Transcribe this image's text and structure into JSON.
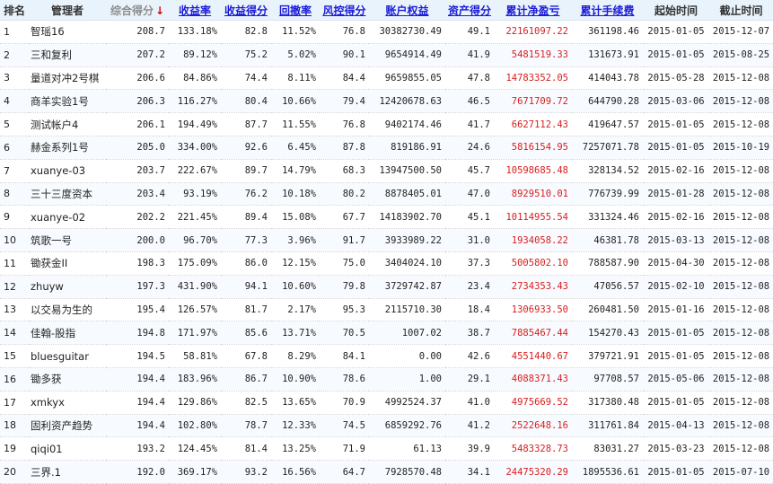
{
  "headers": {
    "rank": "排名",
    "manager": "管理者",
    "score": "综合得分",
    "score_arrow": "↓",
    "return_rate": "收益率",
    "return_score": "收益得分",
    "drawdown": "回撤率",
    "risk_score": "风控得分",
    "equity": "账户权益",
    "asset_score": "资产得分",
    "net_profit": "累计净盈亏",
    "fee": "累计手续费",
    "start": "起始时间",
    "end": "截止时间"
  },
  "colors": {
    "link": "#1a1ad8",
    "profit": "#d81e1e",
    "header_bg": "#e9f3fb"
  },
  "rows": [
    {
      "rank": "1",
      "name": "智瑶16",
      "score": "208.7",
      "return_rate": "133.18%",
      "return_score": "82.8",
      "drawdown": "11.52%",
      "risk_score": "76.8",
      "equity": "30382730.49",
      "asset_score": "49.1",
      "net_profit": "22161097.22",
      "fee": "361198.46",
      "start": "2015-01-05",
      "end": "2015-12-07"
    },
    {
      "rank": "2",
      "name": "三和复利",
      "score": "207.2",
      "return_rate": "89.12%",
      "return_score": "75.2",
      "drawdown": "5.02%",
      "risk_score": "90.1",
      "equity": "9654914.49",
      "asset_score": "41.9",
      "net_profit": "5481519.33",
      "fee": "131673.91",
      "start": "2015-01-05",
      "end": "2015-08-25"
    },
    {
      "rank": "3",
      "name": "量道对冲2号棋",
      "score": "206.6",
      "return_rate": "84.86%",
      "return_score": "74.4",
      "drawdown": "8.11%",
      "risk_score": "84.4",
      "equity": "9659855.05",
      "asset_score": "47.8",
      "net_profit": "14783352.05",
      "fee": "414043.78",
      "start": "2015-05-28",
      "end": "2015-12-08"
    },
    {
      "rank": "4",
      "name": "商羊实验1号",
      "score": "206.3",
      "return_rate": "116.27%",
      "return_score": "80.4",
      "drawdown": "10.66%",
      "risk_score": "79.4",
      "equity": "12420678.63",
      "asset_score": "46.5",
      "net_profit": "7671709.72",
      "fee": "644790.28",
      "start": "2015-03-06",
      "end": "2015-12-08"
    },
    {
      "rank": "5",
      "name": "测试帐户4",
      "score": "206.1",
      "return_rate": "194.49%",
      "return_score": "87.7",
      "drawdown": "11.55%",
      "risk_score": "76.8",
      "equity": "9402174.46",
      "asset_score": "41.7",
      "net_profit": "6627112.43",
      "fee": "419647.57",
      "start": "2015-01-05",
      "end": "2015-12-08"
    },
    {
      "rank": "6",
      "name": "赫金系列1号",
      "score": "205.0",
      "return_rate": "334.00%",
      "return_score": "92.6",
      "drawdown": "6.45%",
      "risk_score": "87.8",
      "equity": "819186.91",
      "asset_score": "24.6",
      "net_profit": "5816154.95",
      "fee": "7257071.78",
      "start": "2015-01-05",
      "end": "2015-10-19"
    },
    {
      "rank": "7",
      "name": "xuanye-03",
      "score": "203.7",
      "return_rate": "222.67%",
      "return_score": "89.7",
      "drawdown": "14.79%",
      "risk_score": "68.3",
      "equity": "13947500.50",
      "asset_score": "45.7",
      "net_profit": "10598685.48",
      "fee": "328134.52",
      "start": "2015-02-16",
      "end": "2015-12-08"
    },
    {
      "rank": "8",
      "name": "三十三度资本",
      "score": "203.4",
      "return_rate": "93.19%",
      "return_score": "76.2",
      "drawdown": "10.18%",
      "risk_score": "80.2",
      "equity": "8878405.01",
      "asset_score": "47.0",
      "net_profit": "8929510.01",
      "fee": "776739.99",
      "start": "2015-01-28",
      "end": "2015-12-08"
    },
    {
      "rank": "9",
      "name": "xuanye-02",
      "score": "202.2",
      "return_rate": "221.45%",
      "return_score": "89.4",
      "drawdown": "15.08%",
      "risk_score": "67.7",
      "equity": "14183902.70",
      "asset_score": "45.1",
      "net_profit": "10114955.54",
      "fee": "331324.46",
      "start": "2015-02-16",
      "end": "2015-12-08"
    },
    {
      "rank": "10",
      "name": "筑歌一号",
      "score": "200.0",
      "return_rate": "96.70%",
      "return_score": "77.3",
      "drawdown": "3.96%",
      "risk_score": "91.7",
      "equity": "3933989.22",
      "asset_score": "31.0",
      "net_profit": "1934058.22",
      "fee": "46381.78",
      "start": "2015-03-13",
      "end": "2015-12-08"
    },
    {
      "rank": "11",
      "name": "锄获金II",
      "score": "198.3",
      "return_rate": "175.09%",
      "return_score": "86.0",
      "drawdown": "12.15%",
      "risk_score": "75.0",
      "equity": "3404024.10",
      "asset_score": "37.3",
      "net_profit": "5005802.10",
      "fee": "788587.90",
      "start": "2015-04-30",
      "end": "2015-12-08"
    },
    {
      "rank": "12",
      "name": "zhuyw",
      "score": "197.3",
      "return_rate": "431.90%",
      "return_score": "94.1",
      "drawdown": "10.60%",
      "risk_score": "79.8",
      "equity": "3729742.87",
      "asset_score": "23.4",
      "net_profit": "2734353.43",
      "fee": "47056.57",
      "start": "2015-02-10",
      "end": "2015-12-08"
    },
    {
      "rank": "13",
      "name": "以交易为生的",
      "score": "195.4",
      "return_rate": "126.57%",
      "return_score": "81.7",
      "drawdown": "2.17%",
      "risk_score": "95.3",
      "equity": "2115710.30",
      "asset_score": "18.4",
      "net_profit": "1306933.50",
      "fee": "260481.50",
      "start": "2015-01-16",
      "end": "2015-12-08"
    },
    {
      "rank": "14",
      "name": "佳翰-股指",
      "score": "194.8",
      "return_rate": "171.97%",
      "return_score": "85.6",
      "drawdown": "13.71%",
      "risk_score": "70.5",
      "equity": "1007.02",
      "asset_score": "38.7",
      "net_profit": "7885467.44",
      "fee": "154270.43",
      "start": "2015-01-05",
      "end": "2015-12-08"
    },
    {
      "rank": "15",
      "name": "bluesguitar",
      "score": "194.5",
      "return_rate": "58.81%",
      "return_score": "67.8",
      "drawdown": "8.29%",
      "risk_score": "84.1",
      "equity": "0.00",
      "asset_score": "42.6",
      "net_profit": "4551440.67",
      "fee": "379721.91",
      "start": "2015-01-05",
      "end": "2015-12-08"
    },
    {
      "rank": "16",
      "name": "锄多获",
      "score": "194.4",
      "return_rate": "183.96%",
      "return_score": "86.7",
      "drawdown": "10.90%",
      "risk_score": "78.6",
      "equity": "1.00",
      "asset_score": "29.1",
      "net_profit": "4088371.43",
      "fee": "97708.57",
      "start": "2015-05-06",
      "end": "2015-12-08"
    },
    {
      "rank": "17",
      "name": "xmkyx",
      "score": "194.4",
      "return_rate": "129.86%",
      "return_score": "82.5",
      "drawdown": "13.65%",
      "risk_score": "70.9",
      "equity": "4992524.37",
      "asset_score": "41.0",
      "net_profit": "4975669.52",
      "fee": "317380.48",
      "start": "2015-01-05",
      "end": "2015-12-08"
    },
    {
      "rank": "18",
      "name": "固利资产趋势",
      "score": "194.4",
      "return_rate": "102.80%",
      "return_score": "78.7",
      "drawdown": "12.33%",
      "risk_score": "74.5",
      "equity": "6859292.76",
      "asset_score": "41.2",
      "net_profit": "2522648.16",
      "fee": "311761.84",
      "start": "2015-04-13",
      "end": "2015-12-08"
    },
    {
      "rank": "19",
      "name": "qiqi01",
      "score": "193.2",
      "return_rate": "124.45%",
      "return_score": "81.4",
      "drawdown": "13.25%",
      "risk_score": "71.9",
      "equity": "61.13",
      "asset_score": "39.9",
      "net_profit": "5483328.73",
      "fee": "83031.27",
      "start": "2015-03-23",
      "end": "2015-12-08"
    },
    {
      "rank": "20",
      "name": "三界.1",
      "score": "192.0",
      "return_rate": "369.17%",
      "return_score": "93.2",
      "drawdown": "16.56%",
      "risk_score": "64.7",
      "equity": "7928570.48",
      "asset_score": "34.1",
      "net_profit": "24475320.29",
      "fee": "1895536.61",
      "start": "2015-01-05",
      "end": "2015-07-10"
    }
  ]
}
